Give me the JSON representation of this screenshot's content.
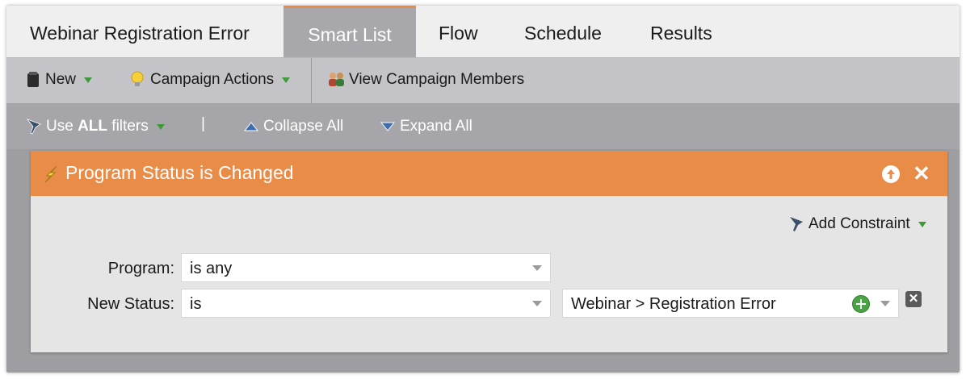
{
  "tabs": [
    {
      "label": "Webinar Registration Error"
    },
    {
      "label": "Smart List"
    },
    {
      "label": "Flow"
    },
    {
      "label": "Schedule"
    },
    {
      "label": "Results"
    }
  ],
  "toolbar": {
    "new_label": "New",
    "campaign_actions_label": "Campaign Actions",
    "view_members_label": "View Campaign Members"
  },
  "filterbar": {
    "use_prefix": "Use ",
    "use_bold": "ALL",
    "use_suffix": " filters",
    "separator": "|",
    "collapse_label": "Collapse All",
    "expand_label": "Expand All"
  },
  "filter": {
    "title": "Program Status is Changed",
    "add_constraint_label": "Add Constraint",
    "rows": [
      {
        "label": "Program:",
        "operator": "is any"
      },
      {
        "label": "New Status:",
        "operator": "is",
        "value": "Webinar > Registration Error"
      }
    ]
  },
  "colors": {
    "accent": "#e98c48",
    "tab_active": "#a8a8ac",
    "toolbar": "#c4c4c8",
    "filterbar": "#a6a6aa"
  }
}
